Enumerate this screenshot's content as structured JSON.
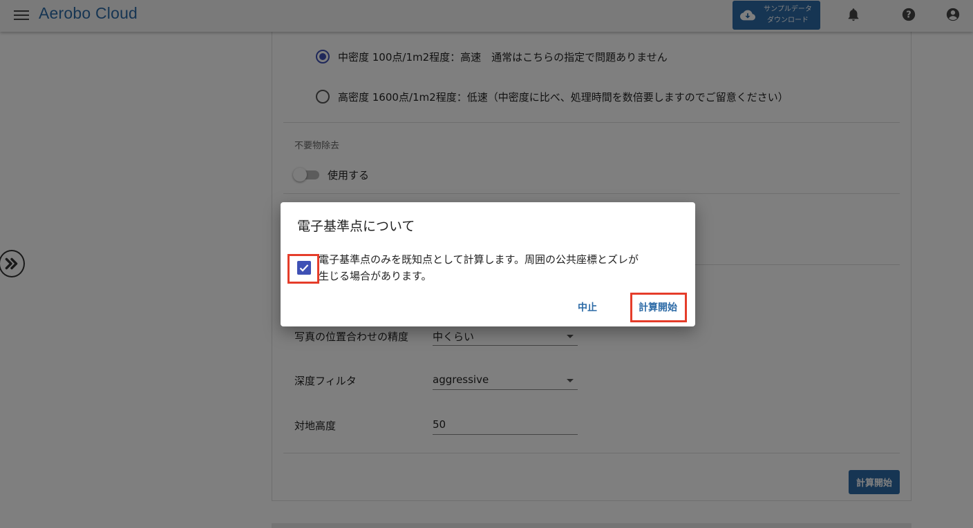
{
  "app": {
    "title": "Aerobo Cloud"
  },
  "header": {
    "download_line1": "サンプルデータ",
    "download_line2": "ダウンロード"
  },
  "density": {
    "options": [
      {
        "label": "中密度 100点/1m2程度：高速　通常はこちらの指定で問題ありません",
        "selected": true
      },
      {
        "label": "高密度 1600点/1m2程度：低速（中密度に比べ、処理時間を数倍要しますのでご留意ください）",
        "selected": false
      }
    ]
  },
  "removal": {
    "section_label": "不要物除去",
    "toggle_label": "使用する",
    "enabled": false
  },
  "settings": {
    "alignment_label": "写真の位置合わせの精度",
    "alignment_value": "中くらい",
    "depth_label": "深度フィルタ",
    "depth_value": "aggressive",
    "height_label": "対地高度",
    "height_value": "50"
  },
  "form": {
    "submit_label": "計算開始"
  },
  "dialog": {
    "title": "電子基準点について",
    "message_line1": "電子基準点のみを既知点として計算します。周囲の公共座標とズレが",
    "message_line2": "生じる場合があります。",
    "checked": true,
    "cancel_label": "中止",
    "start_label": "計算開始"
  },
  "colors": {
    "brand": "#2c6aa6",
    "accent": "#3f51b5",
    "highlight": "#e53d2a"
  }
}
